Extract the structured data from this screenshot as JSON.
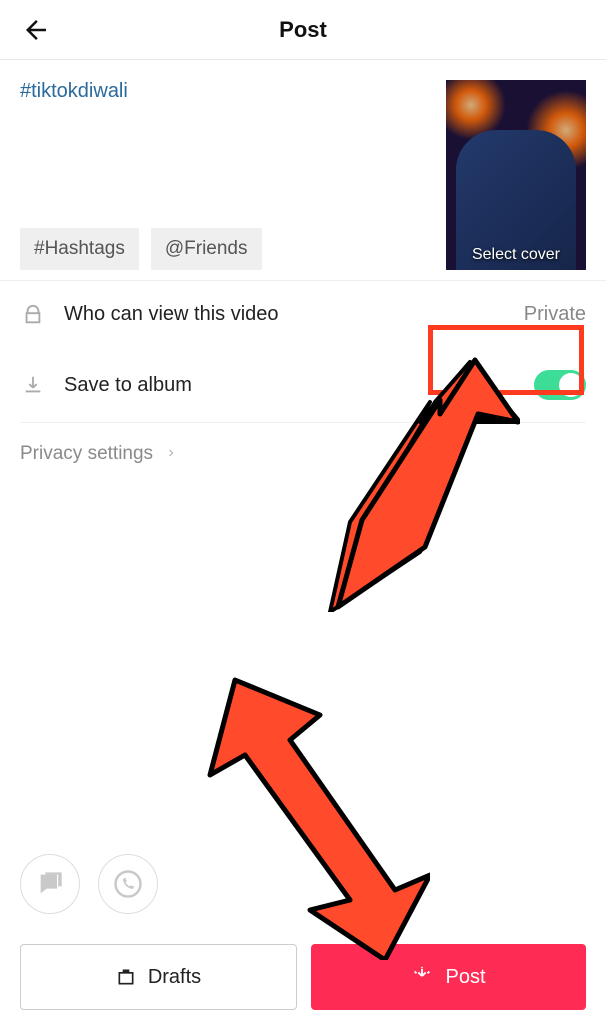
{
  "header": {
    "title": "Post"
  },
  "caption": "#tiktokdiwali",
  "chips": {
    "hashtags": "#Hashtags",
    "friends": "@Friends"
  },
  "thumbnail": {
    "cover_label": "Select cover"
  },
  "privacy_row": {
    "label": "Who can view this video",
    "value": "Private"
  },
  "save_row": {
    "label": "Save to album"
  },
  "privacy_settings": "Privacy settings",
  "buttons": {
    "drafts": "Drafts",
    "post": "Post"
  }
}
